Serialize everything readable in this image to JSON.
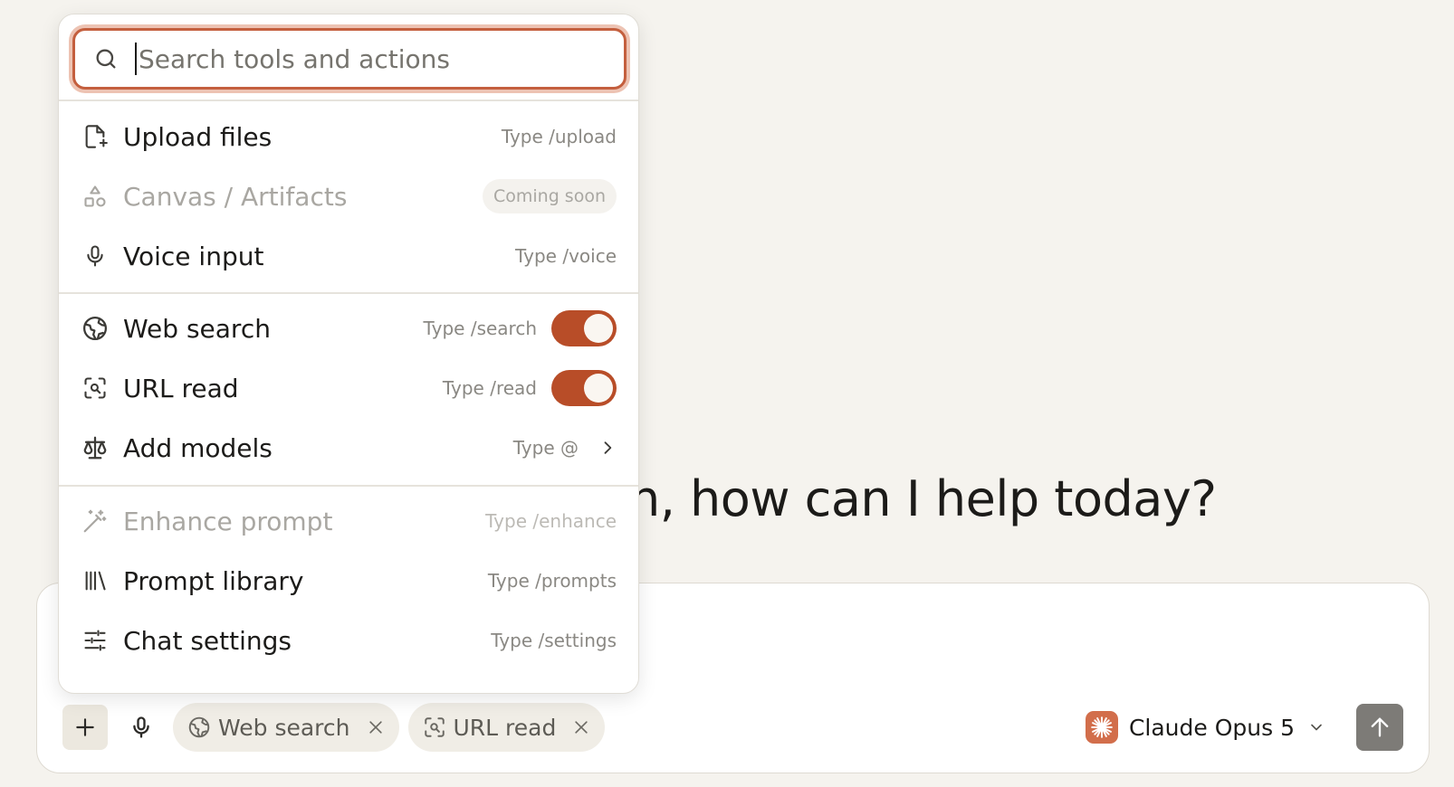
{
  "greeting": {
    "text": "n, how can I help today?"
  },
  "menu": {
    "search": {
      "placeholder": "Search tools and actions"
    },
    "items": [
      {
        "label": "Upload files",
        "hint": "Type /upload",
        "icon": "file-plus-icon"
      },
      {
        "label": "Canvas / Artifacts",
        "badge": "Coming soon",
        "icon": "shapes-icon",
        "disabled": true
      },
      {
        "label": "Voice input",
        "hint": "Type /voice",
        "icon": "microphone-icon"
      },
      {
        "label": "Web search",
        "hint": "Type /search",
        "icon": "globe-icon",
        "toggle": true
      },
      {
        "label": "URL read",
        "hint": "Type /read",
        "icon": "scan-search-icon",
        "toggle": true
      },
      {
        "label": "Add models",
        "hint": "Type @",
        "icon": "scale-icon"
      },
      {
        "label": "Enhance prompt",
        "hint": "Type /enhance",
        "icon": "magic-wand-icon",
        "disabled": true
      },
      {
        "label": "Prompt library",
        "hint": "Type /prompts",
        "icon": "library-icon"
      },
      {
        "label": "Chat settings",
        "hint": "Type /settings",
        "icon": "sliders-icon"
      }
    ]
  },
  "composer": {
    "chips": [
      {
        "label": "Web search",
        "icon": "globe-icon"
      },
      {
        "label": "URL read",
        "icon": "scan-search-icon"
      }
    ],
    "model": {
      "label": "Claude Opus 5"
    }
  },
  "colors": {
    "accent": "#b84d28",
    "focus_ring": "#c45f3e",
    "background": "#f5f3ee",
    "model_logo": "#d26e4b",
    "send_button": "#7d7b77"
  }
}
